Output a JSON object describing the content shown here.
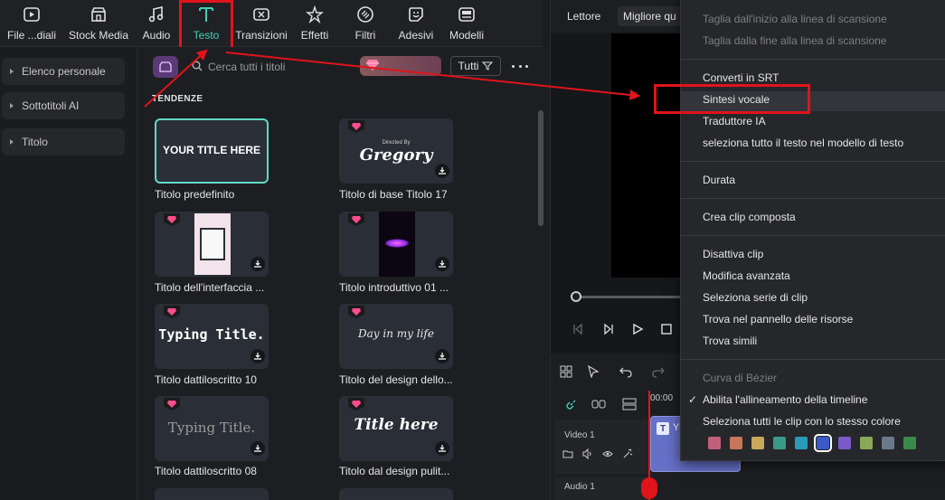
{
  "toolbar": {
    "items": [
      {
        "label": "File ...diali",
        "icon": "media-icon"
      },
      {
        "label": "Stock Media",
        "icon": "stock-icon"
      },
      {
        "label": "Audio",
        "icon": "music-icon"
      },
      {
        "label": "Testo",
        "icon": "text-icon",
        "active": true
      },
      {
        "label": "Transizioni",
        "icon": "transition-icon"
      },
      {
        "label": "Effetti",
        "icon": "effects-icon"
      },
      {
        "label": "Filtri",
        "icon": "filter-icon"
      },
      {
        "label": "Adesivi",
        "icon": "sticker-icon"
      },
      {
        "label": "Modelli",
        "icon": "template-icon"
      }
    ]
  },
  "sidebar": {
    "items": [
      {
        "label": "Elenco personale"
      },
      {
        "label": "Sottotitoli AI"
      },
      {
        "label": "Titolo"
      }
    ]
  },
  "library": {
    "search_placeholder": "Cerca tutti i titoli",
    "filter_label": "Tutti",
    "section_title": "TENDENZE",
    "cards": [
      {
        "name": "Titolo predefinito",
        "preview": "YOUR TITLE HERE",
        "selected": true,
        "premium": false
      },
      {
        "name": "Titolo di base Titolo 17",
        "preview": "Gregory",
        "preview_small": "Directed By",
        "premium": true
      },
      {
        "name": "Titolo dell'interfaccia ...",
        "preview": "",
        "premium": true
      },
      {
        "name": "Titolo introduttivo 01 ...",
        "preview": "",
        "premium": true
      },
      {
        "name": "Titolo dattiloscritto 10",
        "preview": "Typing Title.",
        "premium": true
      },
      {
        "name": "Titolo del design dello...",
        "preview": "Day in my life",
        "premium": true
      },
      {
        "name": "Titolo dattiloscritto 08",
        "preview": "Typing Title.",
        "premium": true
      },
      {
        "name": "Titolo dal design pulit...",
        "preview": "Title here",
        "premium": true
      }
    ]
  },
  "player": {
    "tabs": [
      "Lettore",
      "Migliore qu"
    ]
  },
  "timeline": {
    "ruler_time": "00:00",
    "tracks": [
      {
        "name": "Video 1"
      },
      {
        "name": "Audio 1"
      }
    ],
    "clip_label": "Y"
  },
  "context_menu": {
    "items": [
      {
        "label": "Taglia dall'inizio alla linea di scansione",
        "disabled": true
      },
      {
        "label": "Taglia dalla fine alla linea di scansione",
        "disabled": true
      },
      {
        "label": "Converti in SRT",
        "disabled": false
      },
      {
        "label": "Sintesi vocale",
        "disabled": false,
        "highlighted": true
      },
      {
        "label": "Traduttore IA",
        "disabled": false
      },
      {
        "label": "seleziona tutto il testo nel modello di testo",
        "disabled": false
      },
      {
        "label": "Durata",
        "disabled": false
      },
      {
        "label": "Crea clip composta",
        "disabled": false
      },
      {
        "label": "Disattiva clip",
        "disabled": false
      },
      {
        "label": "Modifica avanzata",
        "disabled": false
      },
      {
        "label": "Seleziona serie di clip",
        "disabled": false
      },
      {
        "label": "Trova nel pannello delle risorse",
        "disabled": false
      },
      {
        "label": "Trova simili",
        "disabled": false
      },
      {
        "label": "Curva di Bézier",
        "disabled": true
      },
      {
        "label": "Abilita l'allineamento della timeline",
        "disabled": false,
        "checked": true
      },
      {
        "label": "Seleziona tutti le clip con lo stesso colore",
        "disabled": false
      }
    ],
    "colors": [
      "#c0607a",
      "#c8765a",
      "#c8a85a",
      "#3a9a8a",
      "#2a9ab8",
      "#3a5ac8",
      "#7a5ac8",
      "#8aa85a",
      "#6a7a8a",
      "#3a8a4a"
    ],
    "selected_color_index": 5
  },
  "colors": {
    "accent": "#3fd1b9",
    "highlight_box": "#e0141a",
    "premium": "#ff4d8d",
    "clip": "#6570c7"
  }
}
